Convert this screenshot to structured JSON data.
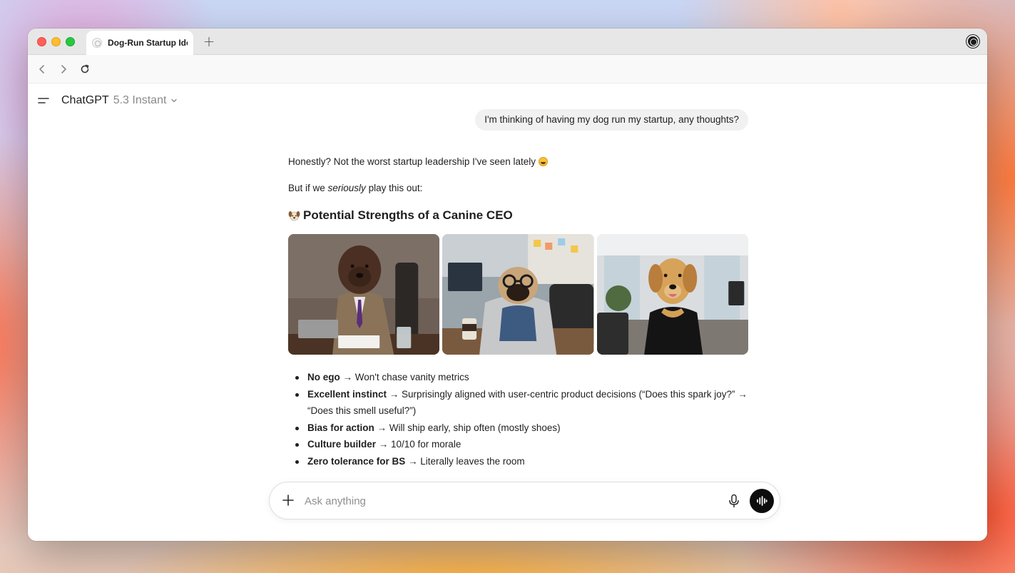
{
  "browser": {
    "tab_title": "Dog-Run Startup Ide",
    "new_tab_symbol": "+"
  },
  "header": {
    "model_name": "ChatGPT",
    "model_version": "5.3 Instant"
  },
  "conversation": {
    "user_message": "I'm thinking of having my dog run my startup, any thoughts?",
    "assistant": {
      "intro_text": "Honestly? Not the worst startup leadership I've seen lately",
      "para2_before": "But if we ",
      "para2_em": "seriously",
      "para2_after": " play this out:",
      "heading": "Potential Strengths of a Canine CEO",
      "images": [
        {
          "name": "doodle-in-suit-image"
        },
        {
          "name": "pug-in-hoodie-image"
        },
        {
          "name": "golden-retriever-in-office-image"
        }
      ],
      "bullets": [
        {
          "bold": "No ego",
          "text": " → Won't chase vanity metrics"
        },
        {
          "bold": "Excellent instinct",
          "text": " → Surprisingly aligned with user-centric product decisions (“Does this spark joy?” → “Does this smell useful?”)"
        },
        {
          "bold": "Bias for action",
          "text": " → Will ship early, ship often (mostly shoes)"
        },
        {
          "bold": "Culture builder",
          "text": " → 10/10 for morale"
        },
        {
          "bold": "Zero tolerance for BS",
          "text": " → Literally leaves the room"
        }
      ]
    }
  },
  "composer": {
    "placeholder": "Ask anything"
  }
}
